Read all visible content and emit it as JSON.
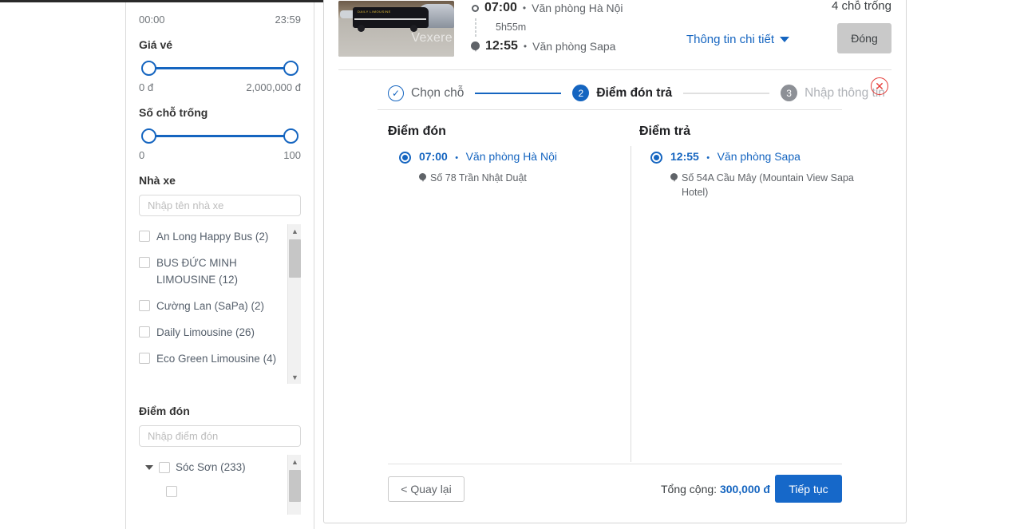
{
  "sidebar": {
    "time_range": {
      "min_label": "00:00",
      "max_label": "23:59"
    },
    "price": {
      "title": "Giá vé",
      "min_label": "0 đ",
      "max_label": "2,000,000 đ"
    },
    "seats": {
      "title": "Số chỗ trống",
      "min_label": "0",
      "max_label": "100"
    },
    "operator": {
      "title": "Nhà xe",
      "placeholder": "Nhập tên nhà xe",
      "value": "",
      "items": [
        {
          "label": "An Long Happy Bus (2)",
          "checked": false
        },
        {
          "label": "BUS ĐỨC MINH LIMOUSINE (12)",
          "checked": false
        },
        {
          "label": "Cường Lan (SaPa) (2)",
          "checked": false
        },
        {
          "label": "Daily Limousine (26)",
          "checked": false
        },
        {
          "label": "Eco Green Limousine (4)",
          "checked": false
        }
      ]
    },
    "pickup_filter": {
      "title": "Điểm đón",
      "placeholder": "Nhập điểm đón",
      "value": "",
      "items": [
        {
          "label": "Sóc Sơn (233)",
          "checked": false,
          "expandable": true
        }
      ]
    }
  },
  "card": {
    "trip": {
      "depart_time": "07:00",
      "depart_place": "Văn phòng Hà Nội",
      "duration": "5h55m",
      "arrive_time": "12:55",
      "arrive_place": "Văn phòng Sapa",
      "separator": "•",
      "seats_available": "4 chỗ trống",
      "detail_link": "Thông tin chi tiết",
      "close_button": "Đóng",
      "photo_watermark": "Vexere",
      "photo_bus_text": "DAILY LIMOUSINE"
    },
    "steps": [
      {
        "label": "Chọn chỗ",
        "badge": "✓",
        "state": "done"
      },
      {
        "label": "Điểm đón trả",
        "badge": "2",
        "state": "active"
      },
      {
        "label": "Nhập thông tin",
        "badge": "3",
        "state": "todo"
      }
    ],
    "close_icon_label": "✕",
    "pickup": {
      "title": "Điểm đón",
      "options": [
        {
          "time": "07:00",
          "separator": "•",
          "name": "Văn phòng Hà Nội",
          "address": "Số 78 Trần Nhật Duật",
          "selected": true
        }
      ]
    },
    "dropoff": {
      "title": "Điểm trả",
      "options": [
        {
          "time": "12:55",
          "separator": "•",
          "name": "Văn phòng Sapa",
          "address": "Số 54A Cầu Mây (Mountain View Sapa Hotel)",
          "selected": true
        }
      ]
    },
    "footer": {
      "back_label": "< Quay lại",
      "total_label": "Tổng cộng:",
      "total_amount": "300,000 đ",
      "next_label": "Tiếp tục"
    }
  },
  "colors": {
    "accent": "#1565C0",
    "primary_button": "#1668C9",
    "danger": "#e53935",
    "muted": "#5f6368"
  }
}
